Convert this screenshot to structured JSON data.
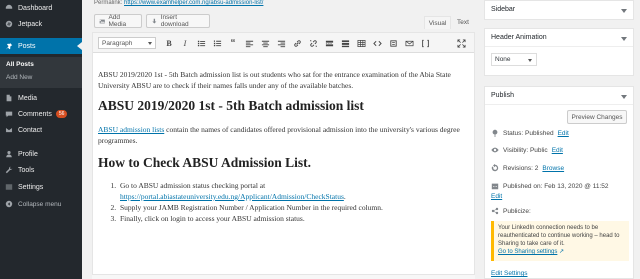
{
  "admin_menu": {
    "items": [
      {
        "key": "dashboard",
        "label": "Dashboard",
        "icon": "dashboard-icon"
      },
      {
        "key": "jetpack",
        "label": "Jetpack",
        "icon": "jetpack-icon"
      },
      {
        "key": "posts",
        "label": "Posts",
        "icon": "pushpin-icon"
      },
      {
        "key": "media",
        "label": "Media",
        "icon": "media-icon"
      },
      {
        "key": "comments",
        "label": "Comments",
        "icon": "comment-icon",
        "badge": "56"
      },
      {
        "key": "contact",
        "label": "Contact",
        "icon": "envelope-icon"
      },
      {
        "key": "profile",
        "label": "Profile",
        "icon": "user-icon"
      },
      {
        "key": "tools",
        "label": "Tools",
        "icon": "wrench-icon"
      },
      {
        "key": "settings",
        "label": "Settings",
        "icon": "settings-icon"
      },
      {
        "key": "collapse",
        "label": "Collapse menu",
        "icon": "collapse-icon"
      }
    ],
    "posts_submenu": [
      "All Posts",
      "Add New"
    ]
  },
  "editor": {
    "permalink_label": "Permalink:",
    "permalink_url": "https://www.examhelper.com.ng/absu-admission-list/",
    "add_media_label": "Add Media",
    "insert_download_label": "Insert download",
    "tab_visual": "Visual",
    "tab_text": "Text",
    "format_select": "Paragraph",
    "content": {
      "intro": "ABSU  2019/2020  1st - 5th Batch admission list is out students who sat for the entrance examination of the Abia State University ABSU are to check if their names falls under any of the available batches.",
      "heading": "ABSU  2019/2020  1st - 5th Batch admission list",
      "p2_link": "ABSU admission lists",
      "p2_rest": " contain the names of candidates offered provisional admission into the university's various degree programmes.",
      "subheading": "How to Check ABSU Admission List.",
      "step1_text": "Go to ABSU admission status checking portal at ",
      "step1_link": "https://portal.abiastateuniversity.edu.ng/Applicant/Admission/CheckStatus",
      "step1_end": ".",
      "step2": "Supply your JAMB Registration Number / Application Number in the required column.",
      "step3": "Finally, click on login to access your ABSU admission status."
    }
  },
  "sidebar_box": {
    "title": "Sidebar"
  },
  "header_animation_box": {
    "title": "Header Animation",
    "select_value": "None"
  },
  "publish_box": {
    "title": "Publish",
    "preview_label": "Preview Changes",
    "status_label": "Status: Published",
    "visibility_label": "Visibility: Public",
    "revisions_label": "Revisions: 2",
    "published_on_label": "Published on: Feb 13, 2020 @ 11:52",
    "edit_label": "Edit",
    "browse_label": "Browse",
    "publicize_label": "Publicize:",
    "notice_text": "Your LinkedIn connection needs to be reauthenticated to continue working – head to Sharing to take care of it.",
    "notice_link": "Go to Sharing settings",
    "edit_settings_label": "Edit Settings"
  }
}
